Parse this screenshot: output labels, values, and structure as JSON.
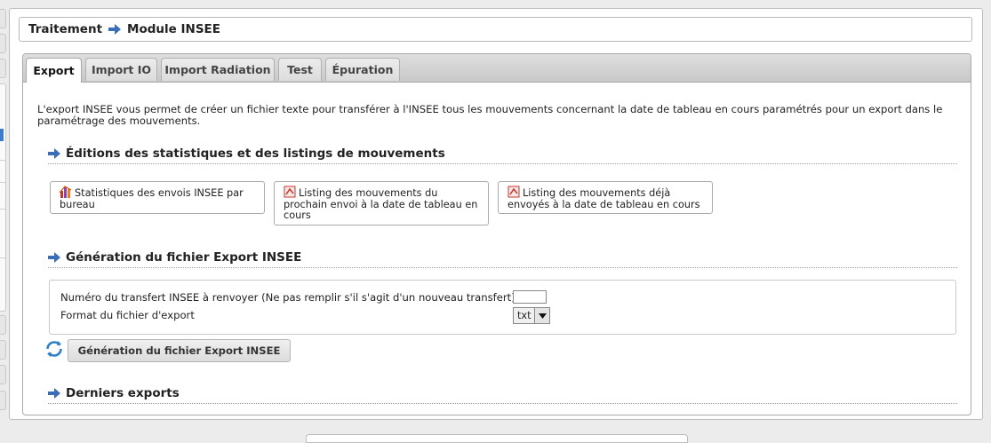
{
  "breadcrumb": {
    "parent": "Traitement",
    "current": "Module INSEE"
  },
  "tabs": [
    {
      "label": "Export",
      "active": true
    },
    {
      "label": "Import IO",
      "active": false
    },
    {
      "label": "Import Radiation",
      "active": false
    },
    {
      "label": "Test",
      "active": false
    },
    {
      "label": "Épuration",
      "active": false
    }
  ],
  "export": {
    "intro": "L'export INSEE vous permet de créer un fichier texte pour transférer à l'INSEE tous les mouvements concernant la date de tableau en cours paramétrés pour un export dans le paramétrage des mouvements.",
    "editions_title": "Éditions des statistiques et des listings de mouvements",
    "buttons": [
      {
        "label": "Statistiques des envois INSEE par bureau",
        "icon": "statistics-chart-icon"
      },
      {
        "label": "Listing des mouvements du prochain envoi à la date de tableau en cours",
        "icon": "pdf-document-icon"
      },
      {
        "label": "Listing des mouvements déjà envoyés à la date de tableau en cours",
        "icon": "pdf-document-icon"
      }
    ],
    "generation_title": "Génération du fichier Export INSEE",
    "form": {
      "numero_label": "Numéro du transfert INSEE à renvoyer (Ne pas remplir s'il s'agit d'un nouveau transfert)",
      "numero_value": "",
      "format_label": "Format du fichier d'export",
      "format_value": "txt"
    },
    "generate_button": "Génération du fichier Export INSEE",
    "derniers_title": "Derniers exports"
  },
  "colors": {
    "arrow": "#3a6fb7",
    "active_tab": "#ffffff",
    "tab_bar": "#cfcfcf"
  }
}
